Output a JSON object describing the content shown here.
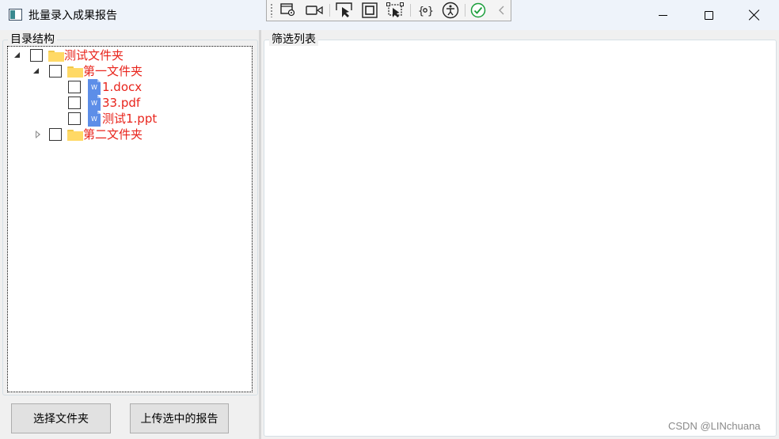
{
  "window": {
    "title": "批量录入成果报告"
  },
  "debug_toolbar": {
    "icons": [
      "select-element-icon",
      "video-record-icon",
      "track-focus-icon",
      "display-layout-adorner-icon",
      "preview-selection-icon",
      "binding-failures-icon",
      "accessibility-icon",
      "hot-reload-ok-icon",
      "collapse-toolbar-icon"
    ]
  },
  "left_panel": {
    "label": "目录结构",
    "tree": [
      {
        "label": "测试文件夹",
        "type": "folder",
        "expanded": true,
        "checked": false,
        "level": 0
      },
      {
        "label": "第一文件夹",
        "type": "folder",
        "expanded": true,
        "checked": false,
        "level": 1
      },
      {
        "label": "1.docx",
        "type": "file",
        "checked": false,
        "level": 2
      },
      {
        "label": "33.pdf",
        "type": "file",
        "checked": false,
        "level": 2
      },
      {
        "label": "测试1.ppt",
        "type": "file",
        "checked": false,
        "level": 2
      },
      {
        "label": "第二文件夹",
        "type": "folder",
        "expanded": false,
        "checked": false,
        "level": 1
      }
    ],
    "file_icon_letter": "W"
  },
  "right_panel": {
    "label": "筛选列表"
  },
  "buttons": {
    "select_folder": "选择文件夹",
    "upload_selected": "上传选中的报告"
  },
  "watermark": "CSDN @LINchuana",
  "colors": {
    "tree_text": "#e8241c",
    "folder": "#ffd966",
    "file_icon": "#5d8ee8",
    "check_green": "#1a9e3a"
  }
}
